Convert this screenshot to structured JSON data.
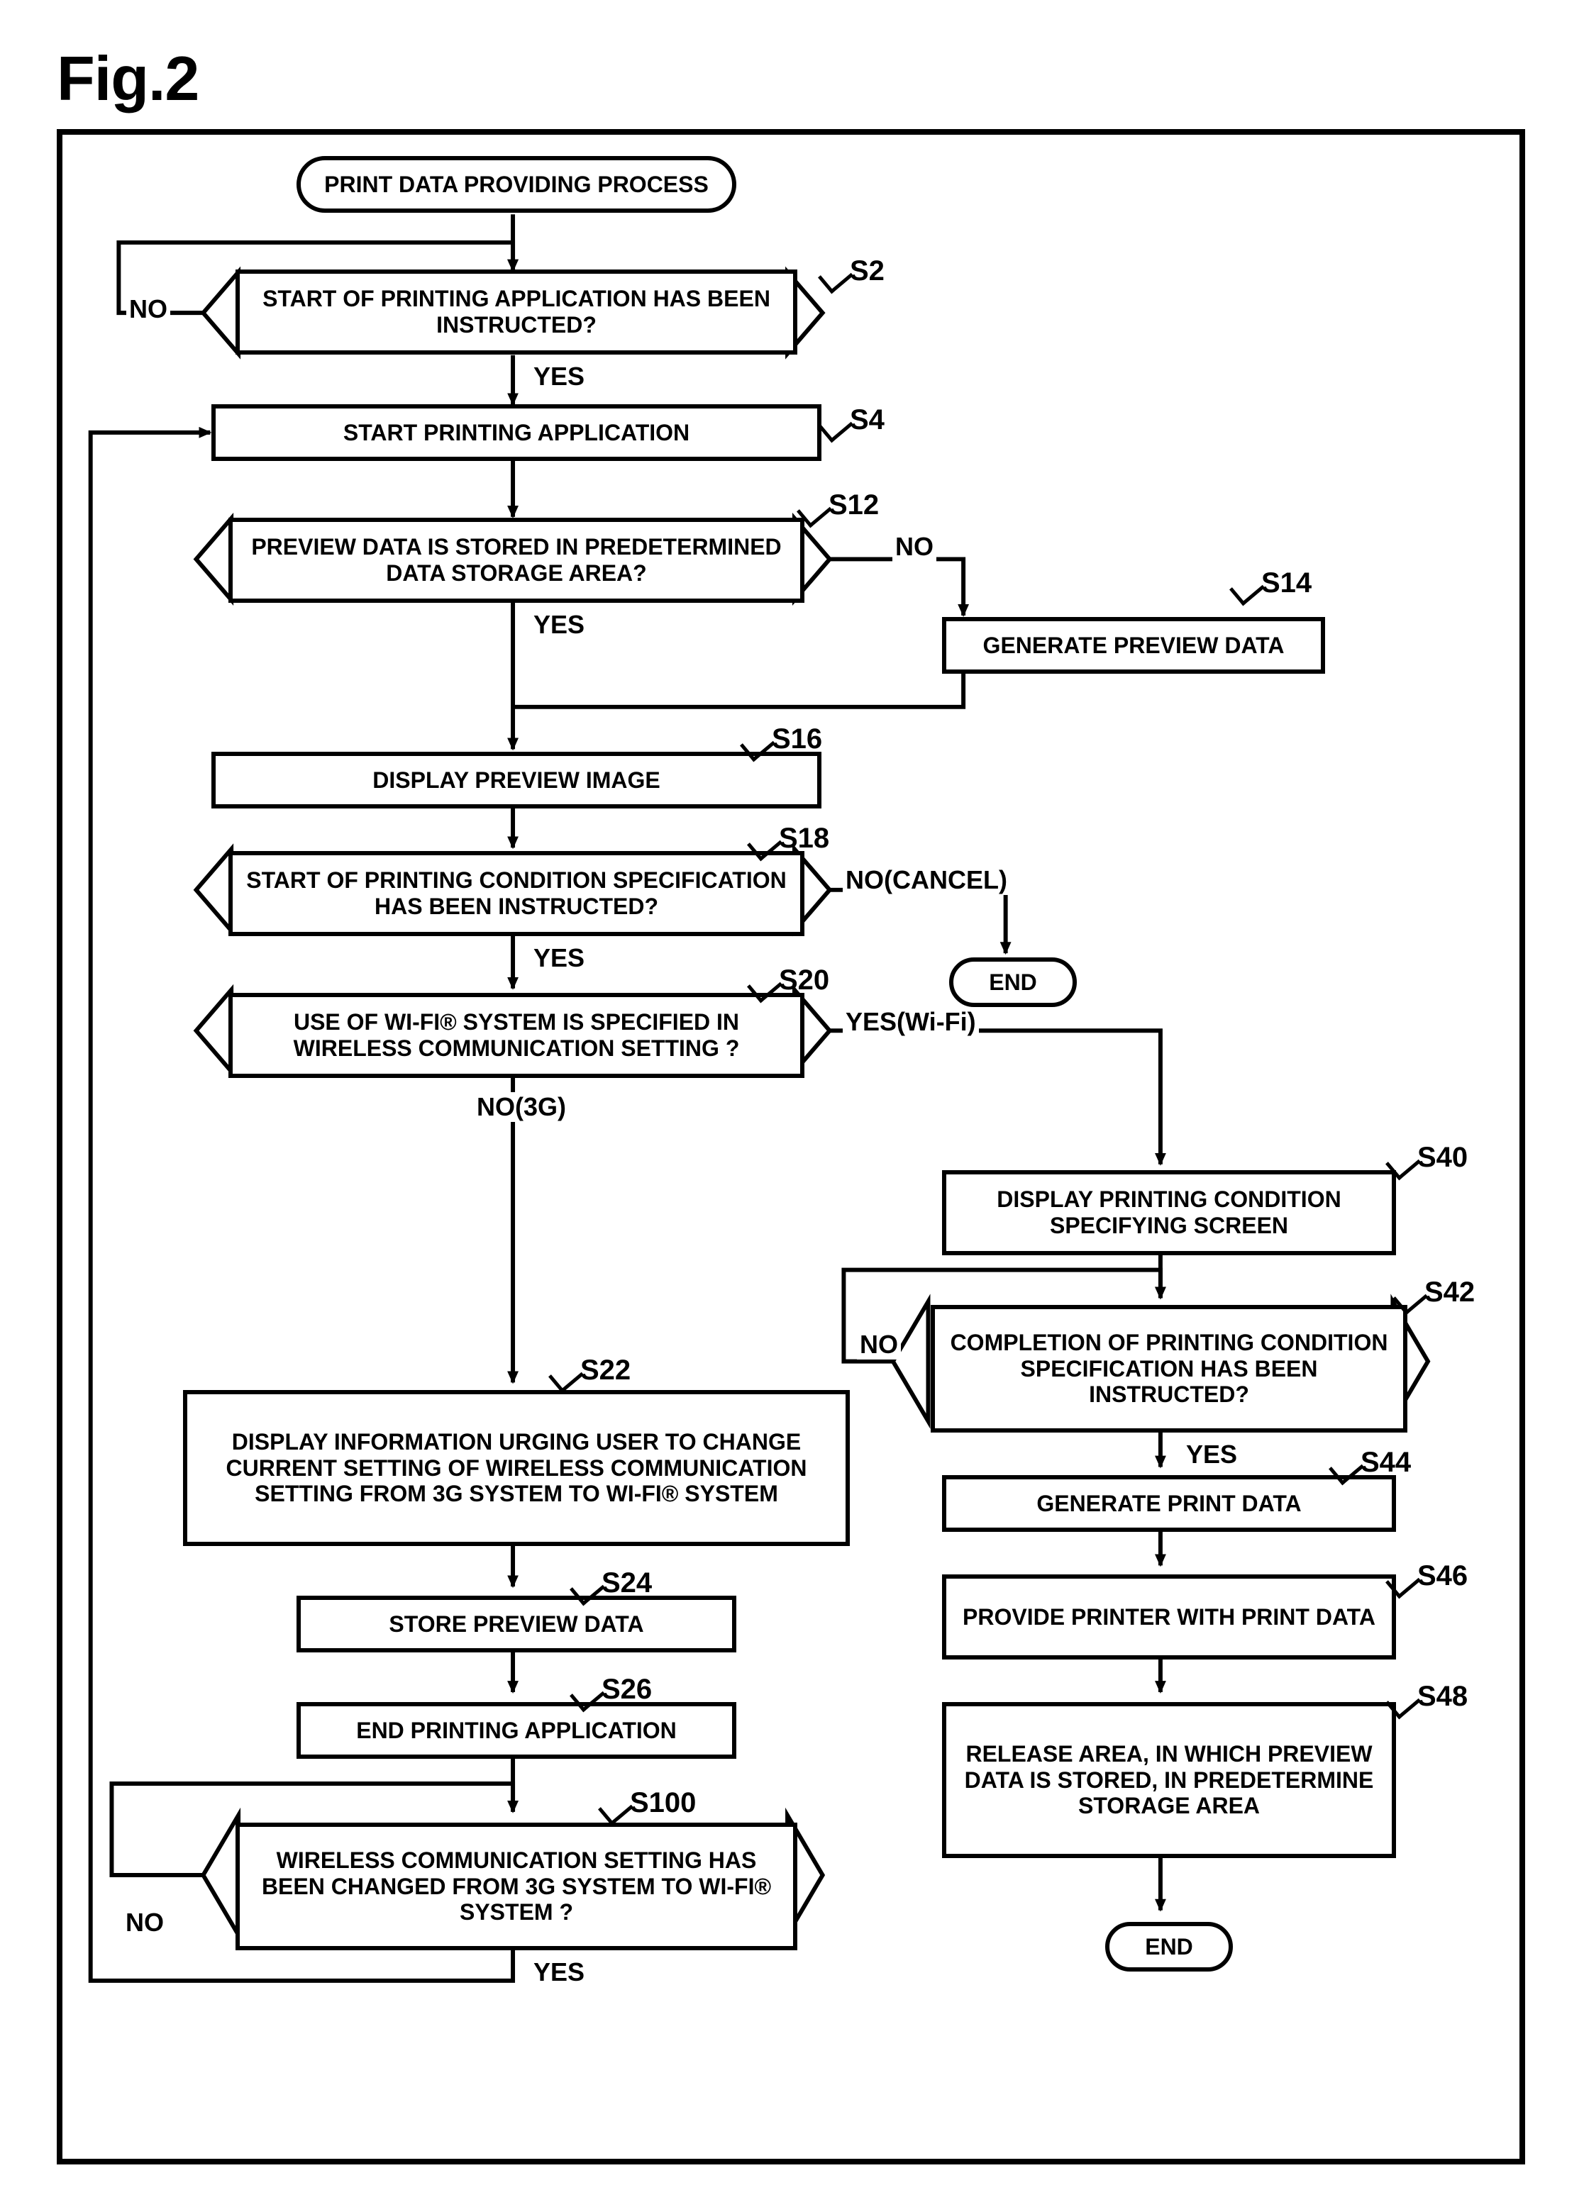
{
  "fig_label": "Fig.2",
  "chart_data": {
    "type": "flowchart",
    "title": "Fig.2",
    "nodes": [
      {
        "id": "start",
        "type": "terminator",
        "text": "PRINT DATA PROVIDING PROCESS"
      },
      {
        "id": "s2",
        "type": "decision",
        "label": "S2",
        "text": "START OF PRINTING APPLICATION HAS BEEN INSTRUCTED?"
      },
      {
        "id": "s4",
        "type": "process",
        "label": "S4",
        "text": "START PRINTING APPLICATION"
      },
      {
        "id": "s12",
        "type": "decision",
        "label": "S12",
        "text": "PREVIEW DATA IS STORED IN PREDETERMINED DATA STORAGE AREA?"
      },
      {
        "id": "s14",
        "type": "process",
        "label": "S14",
        "text": "GENERATE PREVIEW DATA"
      },
      {
        "id": "s16",
        "type": "process",
        "label": "S16",
        "text": "DISPLAY PREVIEW IMAGE"
      },
      {
        "id": "s18",
        "type": "decision",
        "label": "S18",
        "text": "START OF PRINTING CONDITION SPECIFICATION HAS BEEN INSTRUCTED?"
      },
      {
        "id": "end1",
        "type": "terminator",
        "text": "END"
      },
      {
        "id": "s20",
        "type": "decision",
        "label": "S20",
        "text": "USE OF WI-FI® SYSTEM IS SPECIFIED IN WIRELESS COMMUNICATION SETTING ?"
      },
      {
        "id": "s22",
        "type": "process",
        "label": "S22",
        "text": "DISPLAY INFORMATION URGING USER TO CHANGE CURRENT SETTING OF WIRELESS COMMUNICATION SETTING FROM 3G SYSTEM TO WI-FI® SYSTEM"
      },
      {
        "id": "s24",
        "type": "process",
        "label": "S24",
        "text": "STORE PREVIEW DATA"
      },
      {
        "id": "s26",
        "type": "process",
        "label": "S26",
        "text": "END PRINTING APPLICATION"
      },
      {
        "id": "s100",
        "type": "decision",
        "label": "S100",
        "text": "WIRELESS COMMUNICATION SETTING HAS BEEN CHANGED FROM 3G SYSTEM TO WI-FI® SYSTEM ?"
      },
      {
        "id": "s40",
        "type": "process",
        "label": "S40",
        "text": "DISPLAY PRINTING CONDITION SPECIFYING SCREEN"
      },
      {
        "id": "s42",
        "type": "decision",
        "label": "S42",
        "text": "COMPLETION OF PRINTING CONDITION SPECIFICATION HAS BEEN INSTRUCTED?"
      },
      {
        "id": "s44",
        "type": "process",
        "label": "S44",
        "text": "GENERATE PRINT DATA"
      },
      {
        "id": "s46",
        "type": "process",
        "label": "S46",
        "text": "PROVIDE PRINTER WITH PRINT DATA"
      },
      {
        "id": "s48",
        "type": "process",
        "label": "S48",
        "text": "RELEASE AREA, IN WHICH PREVIEW DATA IS STORED, IN PREDETERMINE STORAGE AREA"
      },
      {
        "id": "end2",
        "type": "terminator",
        "text": "END"
      }
    ],
    "edges": [
      {
        "from": "start",
        "to": "s2"
      },
      {
        "from": "s2",
        "to": "s2",
        "label": "NO"
      },
      {
        "from": "s2",
        "to": "s4",
        "label": "YES"
      },
      {
        "from": "s4",
        "to": "s12"
      },
      {
        "from": "s12",
        "to": "s16",
        "label": "YES"
      },
      {
        "from": "s12",
        "to": "s14",
        "label": "NO"
      },
      {
        "from": "s14",
        "to": "s16"
      },
      {
        "from": "s16",
        "to": "s18"
      },
      {
        "from": "s18",
        "to": "end1",
        "label": "NO(CANCEL)"
      },
      {
        "from": "s18",
        "to": "s20",
        "label": "YES"
      },
      {
        "from": "s20",
        "to": "s22",
        "label": "NO(3G)"
      },
      {
        "from": "s20",
        "to": "s40",
        "label": "YES(Wi-Fi)"
      },
      {
        "from": "s22",
        "to": "s24"
      },
      {
        "from": "s24",
        "to": "s26"
      },
      {
        "from": "s26",
        "to": "s100"
      },
      {
        "from": "s100",
        "to": "s100",
        "label": "NO"
      },
      {
        "from": "s100",
        "to": "s4",
        "label": "YES"
      },
      {
        "from": "s40",
        "to": "s42"
      },
      {
        "from": "s42",
        "to": "s42",
        "label": "NO"
      },
      {
        "from": "s42",
        "to": "s44",
        "label": "YES"
      },
      {
        "from": "s44",
        "to": "s46"
      },
      {
        "from": "s46",
        "to": "s48"
      },
      {
        "from": "s48",
        "to": "end2"
      }
    ]
  },
  "labels": {
    "start": "PRINT DATA PROVIDING PROCESS",
    "s2": "START OF PRINTING APPLICATION HAS BEEN INSTRUCTED?",
    "s4": "START PRINTING APPLICATION",
    "s12": "PREVIEW DATA IS STORED IN PREDETERMINED DATA STORAGE AREA?",
    "s14": "GENERATE PREVIEW DATA",
    "s16": "DISPLAY PREVIEW IMAGE",
    "s18": "START OF PRINTING CONDITION SPECIFICATION HAS BEEN INSTRUCTED?",
    "end1": "END",
    "s20": "USE OF WI-FI® SYSTEM IS SPECIFIED IN WIRELESS COMMUNICATION SETTING ?",
    "s22": "DISPLAY INFORMATION URGING USER TO CHANGE CURRENT SETTING OF WIRELESS COMMUNICATION SETTING FROM 3G SYSTEM TO WI-FI® SYSTEM",
    "s24": "STORE PREVIEW DATA",
    "s26": "END PRINTING APPLICATION",
    "s100": "WIRELESS COMMUNICATION SETTING HAS BEEN CHANGED FROM 3G SYSTEM TO WI-FI® SYSTEM ?",
    "s40": "DISPLAY PRINTING CONDITION SPECIFYING SCREEN",
    "s42": "COMPLETION OF PRINTING CONDITION SPECIFICATION HAS BEEN INSTRUCTED?",
    "s44": "GENERATE PRINT DATA",
    "s46": "PROVIDE PRINTER WITH PRINT DATA",
    "s48": "RELEASE AREA, IN WHICH PREVIEW DATA IS STORED, IN PREDETERMINE STORAGE AREA",
    "end2": "END"
  },
  "step_labels": {
    "s2": "S2",
    "s4": "S4",
    "s12": "S12",
    "s14": "S14",
    "s16": "S16",
    "s18": "S18",
    "s20": "S20",
    "s22": "S22",
    "s24": "S24",
    "s26": "S26",
    "s100": "S100",
    "s40": "S40",
    "s42": "S42",
    "s44": "S44",
    "s46": "S46",
    "s48": "S48"
  },
  "edge_labels": {
    "s2_no": "NO",
    "s2_yes": "YES",
    "s12_yes": "YES",
    "s12_no": "NO",
    "s18_yes": "YES",
    "s18_no": "NO(CANCEL)",
    "s20_no": "NO(3G)",
    "s20_yes": "YES(Wi-Fi)",
    "s42_no": "NO",
    "s42_yes": "YES",
    "s100_no": "NO",
    "s100_yes": "YES"
  }
}
